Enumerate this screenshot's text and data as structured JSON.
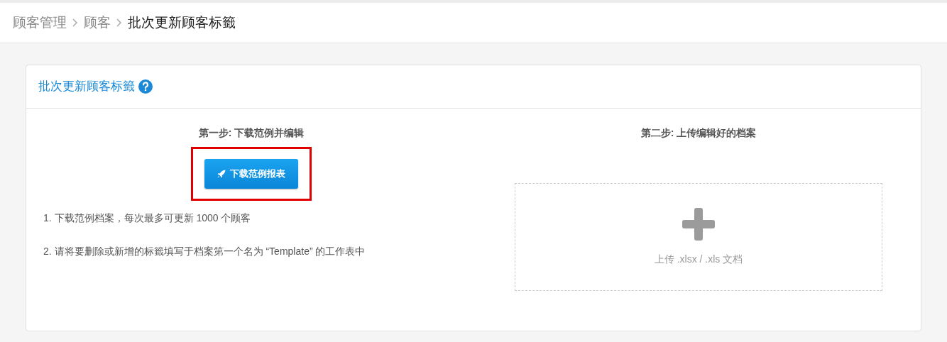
{
  "breadcrumb": [
    {
      "label": "顾客管理",
      "current": false
    },
    {
      "label": "顾客",
      "current": false
    },
    {
      "label": "批次更新顾客标籤",
      "current": true
    }
  ],
  "card": {
    "title": "批次更新顾客标籤",
    "step1": {
      "title": "第一步: 下载范例并编辑",
      "button": {
        "label": "下载范例报表",
        "highlighted": true
      },
      "notes": [
        "1. 下载范例档案，每次最多可更新 1000 个顾客",
        "2. 请将要删除或新增的标籤填写于档案第一个名为 “Template” 的工作表中"
      ]
    },
    "step2": {
      "title": "第二步: 上传编辑好的档案",
      "dropzone": {
        "label": "上传 .xlsx / .xls 文档"
      }
    }
  }
}
